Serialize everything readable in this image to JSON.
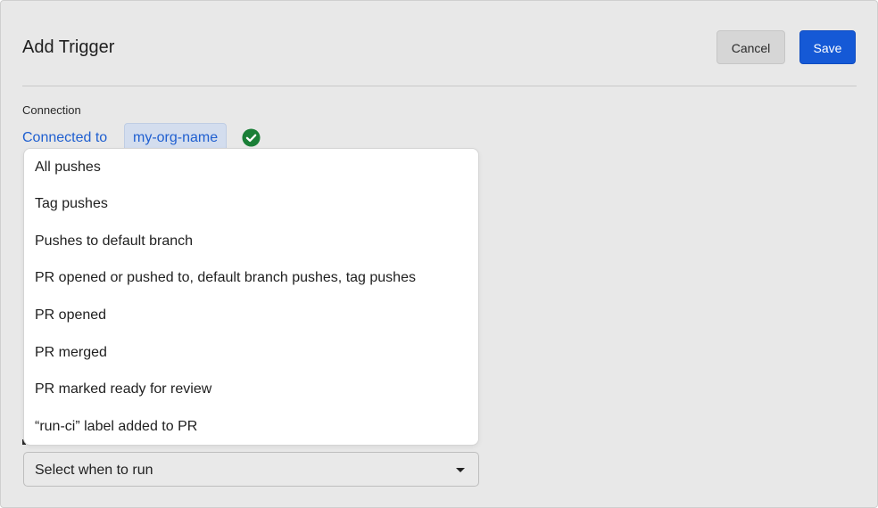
{
  "dialog": {
    "title": "Add Trigger",
    "cancel_label": "Cancel",
    "save_label": "Save"
  },
  "connection": {
    "section_label": "Connection",
    "connected_text": "Connected to",
    "org_name": "my-org-name",
    "status_icon": "check-circle-icon",
    "status_color": "#1a7f37"
  },
  "trigger_select": {
    "value": "Select when to run",
    "options": [
      "All pushes",
      "Tag pushes",
      "Pushes to default branch",
      "PR opened or pushed to, default branch pushes, tag pushes",
      "PR opened",
      "PR merged",
      "PR marked ready for review",
      "“run-ci” label added to PR"
    ]
  },
  "colors": {
    "accent": "#1559d6",
    "link": "#1f5fd0",
    "panel_bg": "#e8e8e8"
  }
}
